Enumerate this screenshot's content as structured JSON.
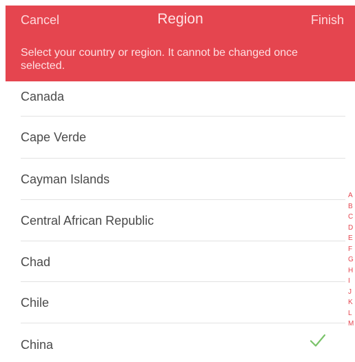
{
  "nav": {
    "cancel_label": "Cancel",
    "title": "Region",
    "finish_label": "Finish"
  },
  "notice": "Select your country or region. It cannot be changed once selected.",
  "countries": [
    {
      "label": "Canada",
      "selected": false
    },
    {
      "label": "Cape Verde",
      "selected": false
    },
    {
      "label": "Cayman Islands",
      "selected": false
    },
    {
      "label": "Central African Republic",
      "selected": false
    },
    {
      "label": "Chad",
      "selected": false
    },
    {
      "label": "Chile",
      "selected": false
    },
    {
      "label": "China",
      "selected": true
    }
  ],
  "index_letters": [
    "A",
    "B",
    "C",
    "D",
    "E",
    "F",
    "G",
    "H",
    "I",
    "J",
    "K",
    "L",
    "M"
  ],
  "colors": {
    "accent": "#e5454f",
    "checkmark": "#7ac36a"
  },
  "icons": {
    "selected": "checkmark-icon"
  }
}
